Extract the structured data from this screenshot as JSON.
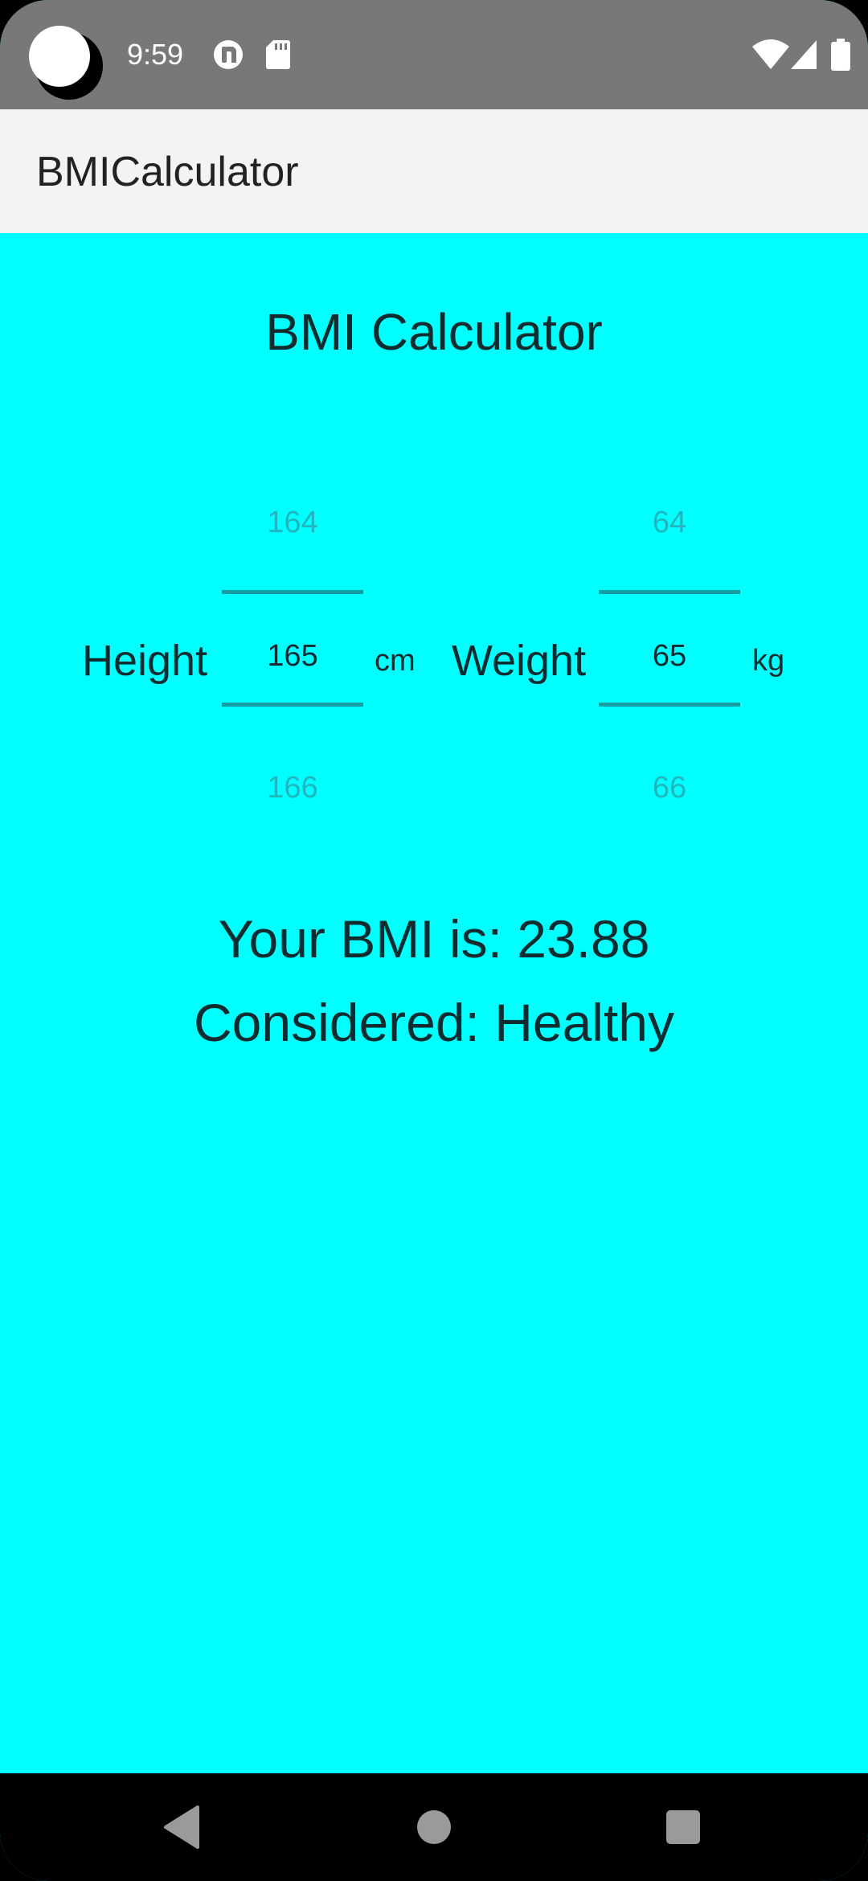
{
  "status_bar": {
    "time": "9:59",
    "icons": [
      "moon-icon",
      "mint-app-icon",
      "sd-card-icon",
      "wifi-icon",
      "cell-signal-icon",
      "battery-icon"
    ]
  },
  "app_bar": {
    "title": "BMICalculator"
  },
  "main": {
    "heading": "BMI Calculator",
    "height": {
      "label": "Height",
      "unit": "cm",
      "prev": "164",
      "current": "165",
      "next": "166"
    },
    "weight": {
      "label": "Weight",
      "unit": "kg",
      "prev": "64",
      "current": "65",
      "next": "66"
    },
    "result": "Your BMI is: 23.88",
    "category": "Considered: Healthy"
  },
  "colors": {
    "background": "#00ffff",
    "status_bar": "#787878",
    "app_bar": "#f3f3f3",
    "picker_divider": "#139ea3",
    "picker_faded_text": "#1fb6bf"
  },
  "nav_bar": {
    "buttons": [
      "back-icon",
      "home-icon",
      "recents-icon"
    ]
  }
}
